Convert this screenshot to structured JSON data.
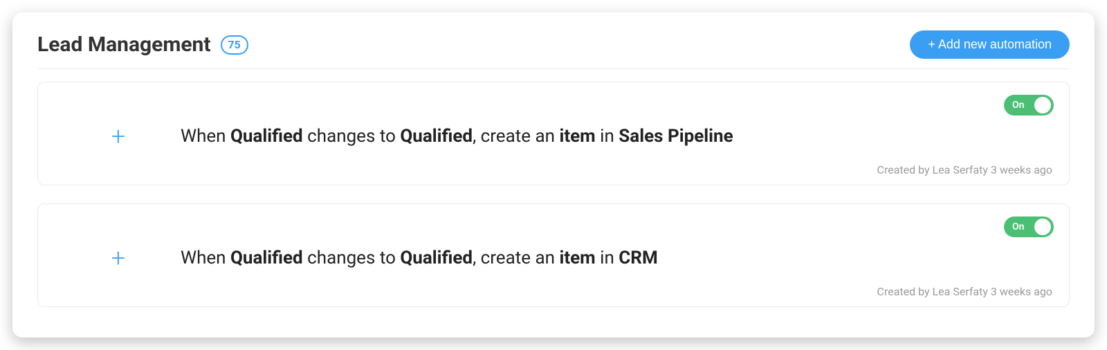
{
  "header": {
    "title": "Lead Management",
    "count": "75",
    "add_button": "+ Add new automation"
  },
  "toggle_label": "On",
  "automations": [
    {
      "w1": "When ",
      "b1": "Qualified",
      "w2": " changes to ",
      "b2": "Qualified",
      "w3": ", create an ",
      "b3": "item",
      "w4": " in ",
      "b4": "Sales Pipeline",
      "created": "Created by Lea Serfaty 3 weeks ago"
    },
    {
      "w1": "When ",
      "b1": "Qualified",
      "w2": " changes to ",
      "b2": "Qualified",
      "w3": ", create an ",
      "b3": "item",
      "w4": " in ",
      "b4": "CRM",
      "created": "Created by Lea Serfaty 3 weeks ago"
    }
  ]
}
